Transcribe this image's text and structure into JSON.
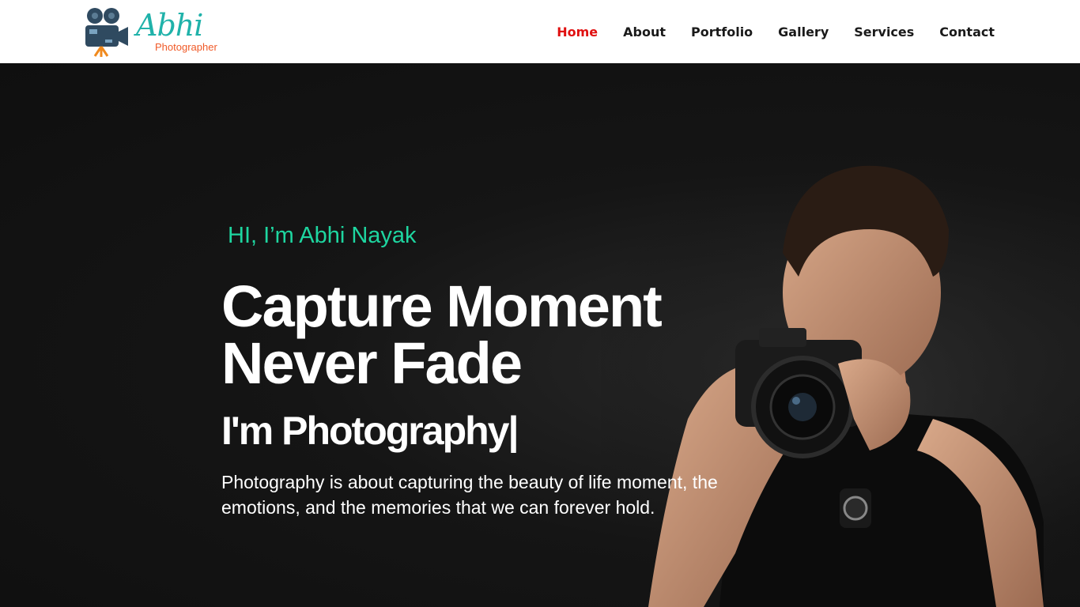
{
  "brand": {
    "name": "Abhi",
    "subtitle": "Photographer"
  },
  "nav": {
    "items": [
      {
        "label": "Home",
        "active": true
      },
      {
        "label": "About",
        "active": false
      },
      {
        "label": "Portfolio",
        "active": false
      },
      {
        "label": "Gallery",
        "active": false
      },
      {
        "label": "Services",
        "active": false
      },
      {
        "label": "Contact",
        "active": false
      }
    ]
  },
  "hero": {
    "greeting": "HI, I’m Abhi Nayak",
    "headline": "Capture Moment Never Fade",
    "tagline": "I'm Photography",
    "cursor": "|",
    "description": "Photography is about capturing the beauty of life moment, the emotions, and the memories that we can forever hold."
  },
  "colors": {
    "accent_active_nav": "#e01010",
    "greeting": "#1ed6a0",
    "logo_teal": "#20b2aa",
    "logo_orange": "#f05a28",
    "hero_background": "#121212"
  },
  "icons": {
    "logo": "movie-camera-icon"
  }
}
